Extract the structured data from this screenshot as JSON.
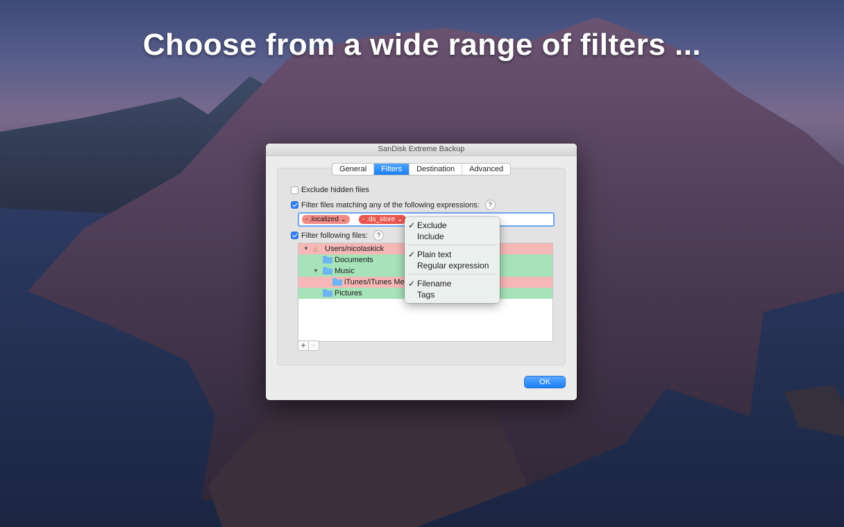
{
  "headline": "Choose from a wide range of filters ...",
  "window": {
    "title": "SanDisk Extreme Backup",
    "tabs": [
      "General",
      "Filters",
      "Destination",
      "Advanced"
    ],
    "active_tab": "Filters",
    "options": {
      "exclude_hidden": {
        "label": "Exclude hidden files",
        "checked": false
      },
      "filter_expressions": {
        "label": "Filter files matching any of the following expressions:",
        "checked": true,
        "help": "?"
      },
      "filter_files": {
        "label": "Filter following files:",
        "checked": true,
        "help": "?"
      }
    },
    "tokens": [
      {
        "text": "- .localized",
        "selected": false
      },
      {
        "text": "- .ds_store",
        "selected": true
      }
    ],
    "files": [
      {
        "name": "Users/nicolaskick",
        "type": "home",
        "state": "exclude",
        "expanded": true
      },
      {
        "name": "Documents",
        "type": "folder",
        "state": "include"
      },
      {
        "name": "Music",
        "type": "folder",
        "state": "include",
        "expanded": true
      },
      {
        "name": "iTunes/iTunes Me",
        "type": "folder",
        "state": "exclude"
      },
      {
        "name": "Pictures",
        "type": "folder",
        "state": "include"
      }
    ],
    "add_button": "+",
    "remove_button": "−",
    "ok_label": "OK"
  },
  "menu": {
    "groups": [
      [
        {
          "label": "Exclude",
          "checked": true
        },
        {
          "label": "Include",
          "checked": false
        }
      ],
      [
        {
          "label": "Plain text",
          "checked": true
        },
        {
          "label": "Regular expression",
          "checked": false
        }
      ],
      [
        {
          "label": "Filename",
          "checked": true
        },
        {
          "label": "Tags",
          "checked": false
        }
      ]
    ],
    "check_glyph": "✓"
  },
  "colors": {
    "exclude": "#f6b8b6",
    "include": "#a6e3b8",
    "accent": "#1a7ff5"
  }
}
